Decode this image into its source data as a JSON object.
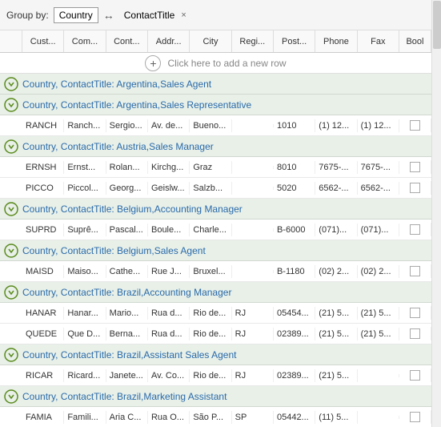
{
  "groupBar": {
    "label": "Group by:",
    "tag1": "Country",
    "separator": "↔",
    "tag2": "ContactTitle",
    "closeSymbol": "×"
  },
  "columns": [
    "Cust...",
    "Com...",
    "Cont...",
    "Addr...",
    "City",
    "Regi...",
    "Post...",
    "Phone",
    "Fax",
    "Bool"
  ],
  "newRow": {
    "text": "Click here to add a new row"
  },
  "groups": [
    {
      "label": "Country, ContactTitle: Argentina,Sales Agent",
      "rows": []
    },
    {
      "label": "Country, ContactTitle: Argentina,Sales Representative",
      "rows": [
        [
          "RANCH",
          "Ranch...",
          "Sergio...",
          "Av. de...",
          "Bueno...",
          "",
          "1010",
          "(1) 12...",
          "(1) 12...",
          false
        ]
      ]
    },
    {
      "label": "Country, ContactTitle: Austria,Sales Manager",
      "rows": [
        [
          "ERNSH",
          "Ernst...",
          "Rolan...",
          "Kirchg...",
          "Graz",
          "",
          "8010",
          "7675-...",
          "7675-...",
          false
        ],
        [
          "PICCO",
          "Piccol...",
          "Georg...",
          "Geislw...",
          "Salzb...",
          "",
          "5020",
          "6562-...",
          "6562-...",
          false
        ]
      ]
    },
    {
      "label": "Country, ContactTitle: Belgium,Accounting Manager",
      "rows": [
        [
          "SUPRD",
          "Suprê...",
          "Pascal...",
          "Boule...",
          "Charle...",
          "",
          "B-6000",
          "(071)...",
          "(071)...",
          false
        ]
      ]
    },
    {
      "label": "Country, ContactTitle: Belgium,Sales Agent",
      "rows": [
        [
          "MAISD",
          "Maiso...",
          "Cathe...",
          "Rue J...",
          "Bruxel...",
          "",
          "B-1180",
          "(02) 2...",
          "(02) 2...",
          false
        ]
      ]
    },
    {
      "label": "Country, ContactTitle: Brazil,Accounting Manager",
      "rows": [
        [
          "HANAR",
          "Hanar...",
          "Mario...",
          "Rua d...",
          "Rio de...",
          "RJ",
          "05454...",
          "(21) 5...",
          "(21) 5...",
          false
        ],
        [
          "QUEDE",
          "Que D...",
          "Berna...",
          "Rua d...",
          "Rio de...",
          "RJ",
          "02389...",
          "(21) 5...",
          "(21) 5...",
          false
        ]
      ]
    },
    {
      "label": "Country, ContactTitle: Brazil,Assistant Sales Agent",
      "rows": [
        [
          "RICAR",
          "Ricard...",
          "Janete...",
          "Av. Co...",
          "Rio de...",
          "RJ",
          "02389...",
          "(21) 5...",
          "",
          false
        ]
      ]
    },
    {
      "label": "Country, ContactTitle: Brazil,Marketing Assistant",
      "rows": [
        [
          "FAMIA",
          "Famili...",
          "Aria C...",
          "Rua O...",
          "São P...",
          "SP",
          "05442...",
          "(11) 5...",
          "",
          false
        ]
      ]
    }
  ]
}
